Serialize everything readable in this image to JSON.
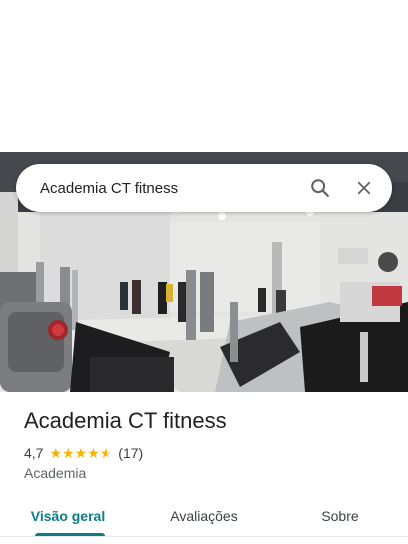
{
  "search": {
    "query": "Academia CT fitness",
    "search_icon": "search-icon",
    "close_icon": "close-icon"
  },
  "place": {
    "name": "Academia CT fitness",
    "rating": "4,7",
    "stars_filled_fraction": 0.94,
    "review_count": "(17)",
    "category": "Academia"
  },
  "tabs": [
    {
      "label": "Visão geral",
      "active": true
    },
    {
      "label": "Avaliações",
      "active": false
    },
    {
      "label": "Sobre",
      "active": false
    }
  ],
  "colors": {
    "accent": "#0b7d86",
    "star": "#f4b400"
  }
}
